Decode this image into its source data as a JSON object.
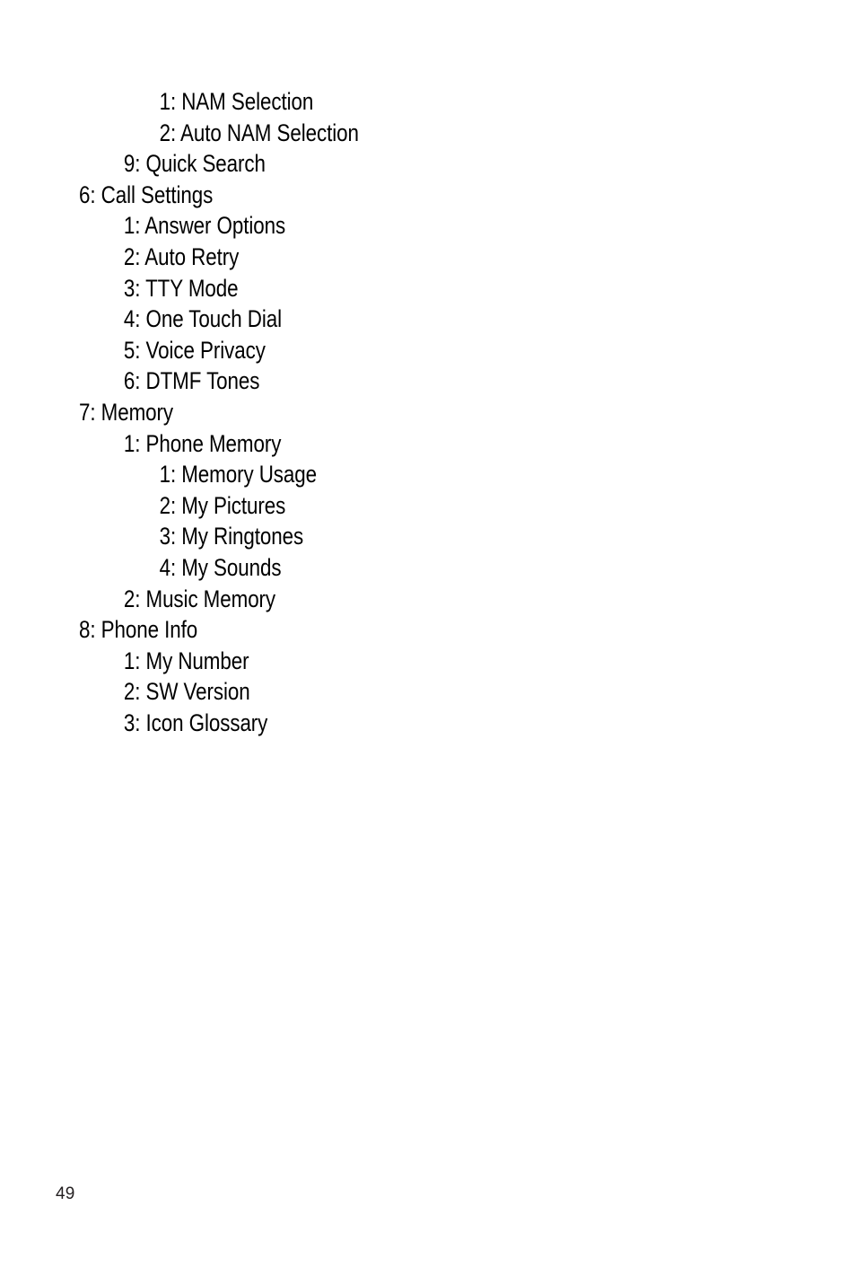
{
  "page": {
    "number": "49",
    "background_color": "#ffffff",
    "text_color": "#000000"
  },
  "menu_outline": {
    "items": [
      {
        "text": "1: NAM Selection",
        "level": 2
      },
      {
        "text": "2: Auto NAM Selection",
        "level": 2
      },
      {
        "text": "9: Quick Search",
        "level": 1
      },
      {
        "text": "6: Call Settings",
        "level": 0
      },
      {
        "text": "1: Answer Options",
        "level": 1
      },
      {
        "text": "2: Auto Retry",
        "level": 1
      },
      {
        "text": "3: TTY Mode",
        "level": 1
      },
      {
        "text": "4: One Touch Dial",
        "level": 1
      },
      {
        "text": "5: Voice Privacy",
        "level": 1
      },
      {
        "text": "6: DTMF Tones",
        "level": 1
      },
      {
        "text": "7: Memory",
        "level": 0
      },
      {
        "text": "1: Phone Memory",
        "level": 1
      },
      {
        "text": "1: Memory Usage",
        "level": 2
      },
      {
        "text": "2: My Pictures",
        "level": 2
      },
      {
        "text": "3: My Ringtones",
        "level": 2
      },
      {
        "text": "4: My Sounds",
        "level": 2
      },
      {
        "text": "2: Music Memory",
        "level": 1
      },
      {
        "text": "8: Phone Info",
        "level": 0
      },
      {
        "text": "1: My Number",
        "level": 1
      },
      {
        "text": "2: SW Version",
        "level": 1
      },
      {
        "text": "3: Icon Glossary",
        "level": 1
      }
    ]
  }
}
